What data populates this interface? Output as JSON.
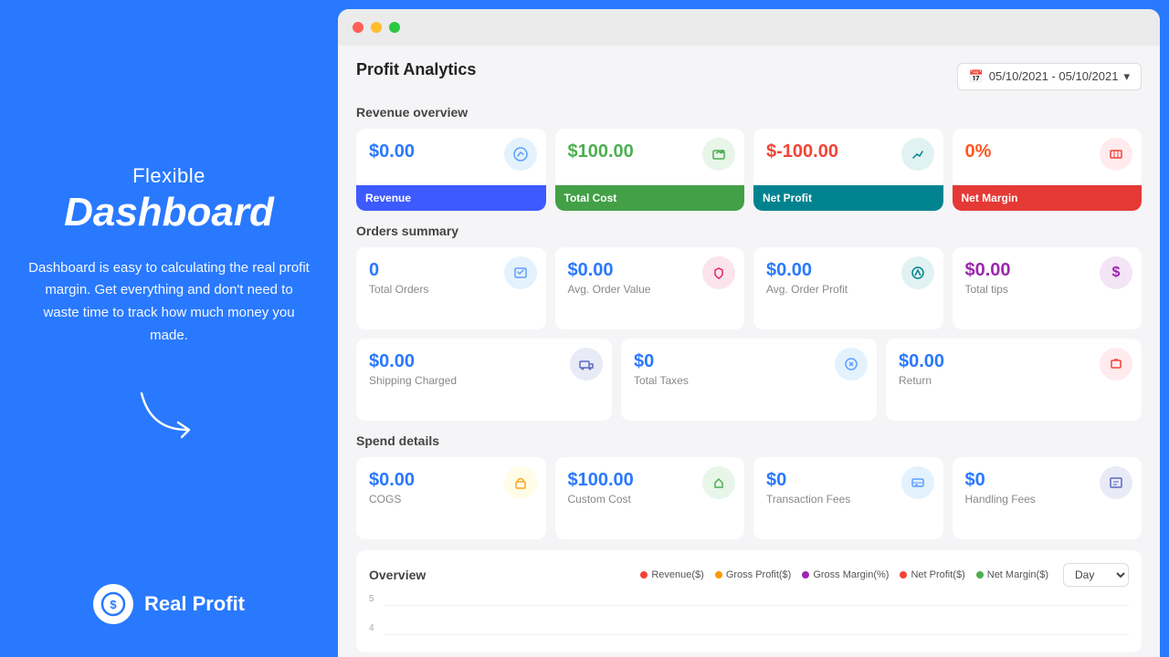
{
  "left": {
    "subtitle": "Flexible",
    "title": "Dashboard",
    "description": "Dashboard is easy to calculating the real profit margin. Get everything and don't need to waste time to track how much money you made.",
    "brand_name": "Real Profit"
  },
  "header": {
    "title": "Profit Analytics",
    "date_range": "05/10/2021 - 05/10/2021"
  },
  "revenue_overview": {
    "section_title": "Revenue overview",
    "cards": [
      {
        "value": "$0.00",
        "label": "Revenue",
        "color": "blue",
        "bar": "Revenue",
        "bar_color": "bar-blue"
      },
      {
        "value": "$100.00",
        "label": "Total Cost",
        "color": "green",
        "bar": "Total Cost",
        "bar_color": "bar-green"
      },
      {
        "value": "$-100.00",
        "label": "Net Profit",
        "color": "red",
        "bar": "Net Profit",
        "bar_color": "bar-teal"
      },
      {
        "value": "0%",
        "label": "Net Margin",
        "color": "orange",
        "bar": "Net Margin",
        "bar_color": "bar-red"
      }
    ]
  },
  "orders_summary": {
    "section_title": "Orders summary",
    "row1": [
      {
        "value": "0",
        "label": "Total Orders",
        "color": "blue",
        "icon": "📦"
      },
      {
        "value": "$0.00",
        "label": "Avg. Order Value",
        "color": "blue",
        "icon": "🛒"
      },
      {
        "value": "$0.00",
        "label": "Avg. Order Profit",
        "color": "blue",
        "icon": "📈"
      },
      {
        "value": "$0.00",
        "label": "Total tips",
        "color": "purple",
        "icon": "💲"
      }
    ],
    "row2": [
      {
        "value": "$0.00",
        "label": "Shipping Charged",
        "color": "blue",
        "icon": "📦"
      },
      {
        "value": "$0",
        "label": "Total Taxes",
        "color": "blue",
        "icon": "🏛"
      },
      {
        "value": "$0.00",
        "label": "Return",
        "color": "blue",
        "icon": "↩"
      }
    ]
  },
  "spend_details": {
    "section_title": "Spend details",
    "cards": [
      {
        "value": "$0.00",
        "label": "COGS",
        "color": "blue",
        "icon": "🏗"
      },
      {
        "value": "$100.00",
        "label": "Custom Cost",
        "color": "blue",
        "icon": "💰"
      },
      {
        "value": "$0",
        "label": "Transaction Fees",
        "color": "blue",
        "icon": "🏦"
      },
      {
        "value": "$0",
        "label": "Handling Fees",
        "color": "blue",
        "icon": "📋"
      }
    ]
  },
  "chart": {
    "section_title": "Overview",
    "day_label": "Day",
    "legend": [
      {
        "label": "Revenue($)",
        "color": "#f44336"
      },
      {
        "label": "Gross Profit($)",
        "color": "#ff9800"
      },
      {
        "label": "Gross Margin(%)",
        "color": "#9c27b0"
      },
      {
        "label": "Net Profit($)",
        "color": "#f44336"
      },
      {
        "label": "Net Margin($)",
        "color": "#4caf50"
      }
    ],
    "y_labels": [
      "5",
      "4"
    ]
  }
}
